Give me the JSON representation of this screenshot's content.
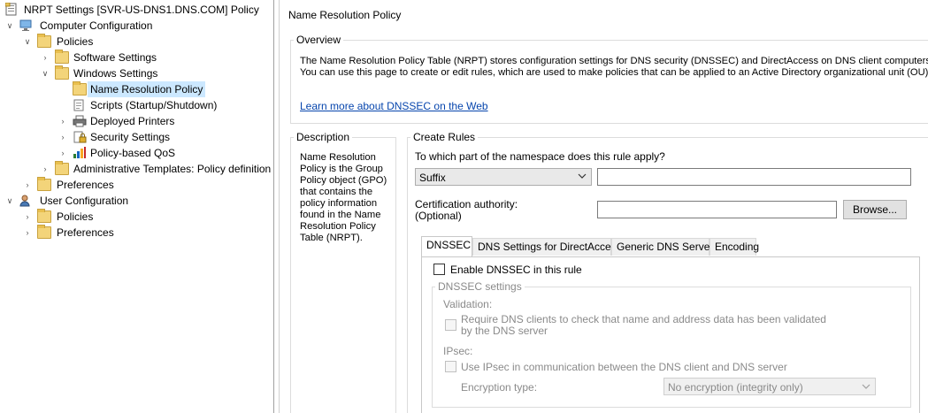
{
  "tree": {
    "root": "NRPT Settings [SVR-US-DNS1.DNS.COM] Policy",
    "computer_config": "Computer Configuration",
    "policies": "Policies",
    "software_settings": "Software Settings",
    "windows_settings": "Windows Settings",
    "name_resolution_policy": "Name Resolution Policy",
    "scripts": "Scripts (Startup/Shutdown)",
    "deployed_printers": "Deployed Printers",
    "security_settings": "Security Settings",
    "policy_qos": "Policy-based QoS",
    "admin_templates": "Administrative Templates: Policy definition",
    "preferences": "Preferences",
    "user_config": "User Configuration",
    "user_policies": "Policies",
    "user_preferences": "Preferences"
  },
  "right": {
    "header": "Name Resolution Policy",
    "overview": {
      "title": "Overview",
      "line1": "The Name Resolution Policy Table (NRPT) stores configuration settings for DNS security (DNSSEC) and DirectAccess on DNS client computers.",
      "line2": "You can use this page to create or edit rules, which are used to make policies that can be applied to an Active Directory organizational unit (OU).",
      "link": "Learn more about DNSSEC on the Web"
    },
    "description": {
      "title": "Description",
      "text": "Name Resolution Policy is the Group Policy object (GPO) that contains the policy information found in the Name Resolution Policy Table (NRPT)."
    },
    "create_rules": {
      "title": "Create Rules",
      "question": "To which part of the namespace does this rule apply?",
      "namespace_value": "Suffix",
      "namespace_input": "",
      "cert_label_1": "Certification authority:",
      "cert_label_2": "(Optional)",
      "cert_input": "",
      "browse": "Browse..."
    },
    "tabs": [
      "DNSSEC",
      "DNS Settings for DirectAccess",
      "Generic DNS Server",
      "Encoding"
    ],
    "dnssec": {
      "enable": "Enable DNSSEC in this rule",
      "settings_title": "DNSSEC settings",
      "validation": "Validation:",
      "require_line1": "Require DNS clients to check that name and address data has been validated",
      "require_line2": "by the DNS server",
      "ipsec": "IPsec:",
      "use_ipsec": "Use IPsec in communication between the DNS client and DNS server",
      "encryption_label": "Encryption type:",
      "encryption_value": "No encryption (integrity only)"
    }
  }
}
